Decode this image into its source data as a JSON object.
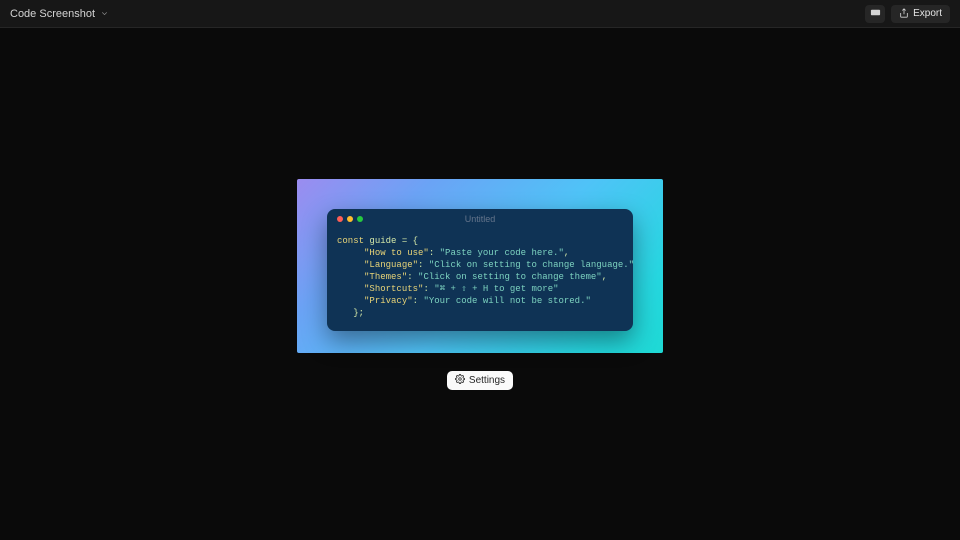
{
  "header": {
    "title": "Code Screenshot",
    "export_label": "Export"
  },
  "window": {
    "title": "Untitled"
  },
  "code": {
    "kw_const": "const",
    "var_name": "guide",
    "op_eq": "=",
    "brace_open": "{",
    "k1": "\"How to use\"",
    "v1": "\"Paste your code here.\"",
    "k2": "\"Language\"",
    "v2": "\"Click on setting to change language.\"",
    "k3": "\"Themes\"",
    "v3": "\"Click on setting to change theme\"",
    "k4": "\"Shortcuts\"",
    "v4": "\"⌘ + ⇧ + H to get more\"",
    "k5": "\"Privacy\"",
    "v5": "\"Your code will not be stored.\"",
    "brace_close_semi": "};"
  },
  "settings_label": "Settings"
}
